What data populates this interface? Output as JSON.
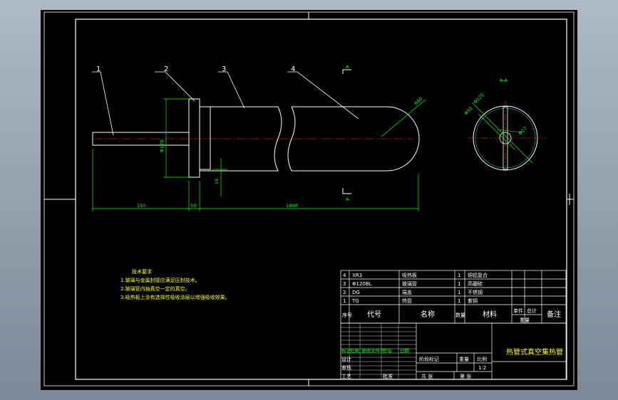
{
  "drawing_title": "热管式真空集热管",
  "part_labels": [
    "1",
    "2",
    "3",
    "4"
  ],
  "dimensions": {
    "d1": "150",
    "d2": "50",
    "d3": "1800",
    "dia_v": "Φ120",
    "d_small": "16",
    "r_end": "R60",
    "sec_a": "Φ120",
    "sec_b": "Φ52",
    "sec_c": "Φ17"
  },
  "section": {
    "mark_top": "A",
    "mark_bot": "A",
    "title": "A-A"
  },
  "notes": {
    "title": "技术要求",
    "lines": [
      "1.玻璃与金属封接应满足压封技术。",
      "2.玻璃管内抽真空一定的真空。",
      "3.吸热板上涂有选择性吸收涂层以增强吸收效果。"
    ]
  },
  "bom": {
    "rows": [
      {
        "no": "4",
        "code": "XR3",
        "name": "吸热板",
        "qty": "1",
        "material": "铜铝复合"
      },
      {
        "no": "3",
        "code": "Φ120BL",
        "name": "玻璃管",
        "qty": "1",
        "material": "高硼硅"
      },
      {
        "no": "2",
        "code": "DG",
        "name": "端盖",
        "qty": "1",
        "material": "不锈钢"
      },
      {
        "no": "1",
        "code": "TG",
        "name": "热管",
        "qty": "1",
        "material": "紫铜"
      }
    ],
    "header": {
      "no": "序号",
      "code": "代号",
      "name": "名称",
      "qty": "数量",
      "material": "材料",
      "single": "单件",
      "total": "总计",
      "weight": "重量",
      "remark": "备注"
    }
  },
  "title_block": {
    "sign_labels": [
      "标记",
      "处数",
      "更改文件号",
      "签名",
      "日期"
    ],
    "rows_labels": [
      "设计",
      "审核",
      "工艺",
      "批准"
    ],
    "stage_labels": [
      "阶段标记",
      "重量",
      "比例"
    ],
    "scale": "1:2",
    "sheet": "共 张",
    "sheet2": "第 张"
  },
  "colors": {
    "line": "#ffffff",
    "green": "#00ff00",
    "yellow": "#ffff00",
    "cyan": "#00ffff"
  }
}
